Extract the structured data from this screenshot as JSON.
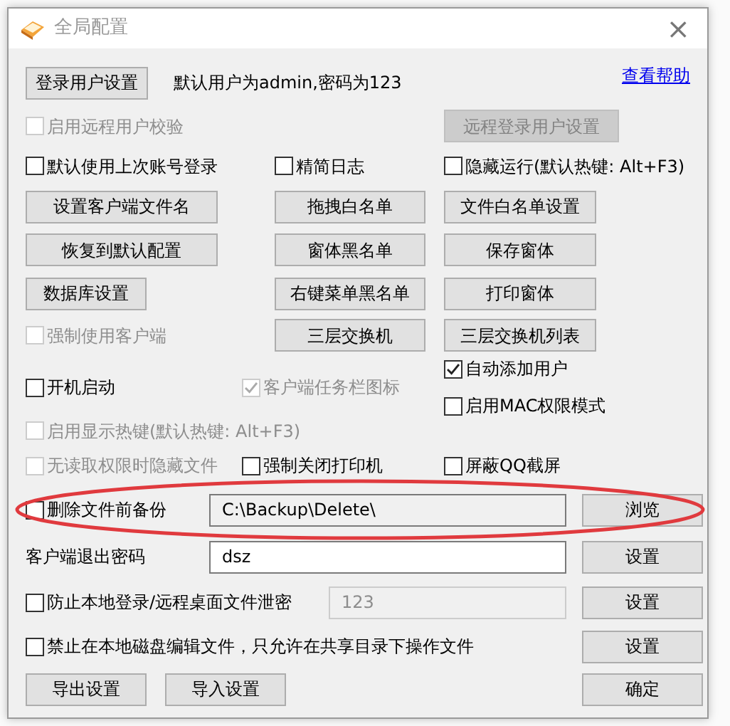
{
  "window": {
    "title": "全局配置",
    "close": "×"
  },
  "rows": [
    {
      "items": [
        {
          "kind": "button",
          "label": "登录用户设置",
          "disabled": false
        },
        {
          "kind": "text",
          "text": "默认用户为admin,密码为123"
        },
        {
          "kind": "link",
          "text": "查看帮助"
        }
      ]
    },
    {
      "items": [
        {
          "kind": "checkbox",
          "label": "启用远程用户校验",
          "checked": false,
          "disabled": true
        },
        {
          "kind": "button",
          "label": "远程登录用户设置",
          "disabled": true
        }
      ]
    },
    {
      "items": [
        {
          "kind": "checkbox",
          "label": "默认使用上次账号登录",
          "checked": false,
          "disabled": false
        },
        {
          "kind": "checkbox",
          "label": "精简日志",
          "checked": false,
          "disabled": false
        },
        {
          "kind": "checkbox",
          "label": "隐藏运行(默认热键: Alt+F3)",
          "checked": false,
          "disabled": false
        }
      ]
    },
    {
      "items": [
        {
          "kind": "button",
          "label": "设置客户端文件名",
          "disabled": false
        },
        {
          "kind": "button",
          "label": "拖拽白名单",
          "disabled": false
        },
        {
          "kind": "button",
          "label": "文件白名单设置",
          "disabled": false
        }
      ]
    },
    {
      "items": [
        {
          "kind": "button",
          "label": "恢复到默认配置",
          "disabled": false
        },
        {
          "kind": "button",
          "label": "窗体黑名单",
          "disabled": false
        },
        {
          "kind": "button",
          "label": "保存窗体",
          "disabled": false
        }
      ]
    },
    {
      "items": [
        {
          "kind": "button",
          "label": "数据库设置",
          "disabled": false
        },
        {
          "kind": "button",
          "label": "右键菜单黑名单",
          "disabled": false
        },
        {
          "kind": "button",
          "label": "打印窗体",
          "disabled": false
        }
      ]
    },
    {
      "items": [
        {
          "kind": "checkbox",
          "label": "强制使用客户端",
          "checked": false,
          "disabled": true
        },
        {
          "kind": "button",
          "label": "三层交换机",
          "disabled": false
        },
        {
          "kind": "button",
          "label": "三层交换机列表",
          "disabled": false
        }
      ]
    },
    {
      "items": [
        {
          "kind": "checkbox",
          "label": "开机启动",
          "checked": false,
          "disabled": false
        },
        {
          "kind": "checkbox",
          "label": "客户端任务栏图标",
          "checked": true,
          "disabled": true
        },
        {
          "kind": "checkbox",
          "label": "自动添加用户",
          "checked": true,
          "disabled": false
        },
        {
          "kind": "checkbox",
          "label": "启用MAC权限模式",
          "checked": false,
          "disabled": false
        }
      ]
    },
    {
      "items": [
        {
          "kind": "checkbox",
          "label": "启用显示热键(默认热键: Alt+F3)",
          "checked": false,
          "disabled": true
        }
      ]
    },
    {
      "items": [
        {
          "kind": "checkbox",
          "label": "无读取权限时隐藏文件",
          "checked": false,
          "disabled": true
        },
        {
          "kind": "checkbox",
          "label": "强制关闭打印机",
          "checked": false,
          "disabled": false
        },
        {
          "kind": "checkbox",
          "label": "屏蔽QQ截屏",
          "checked": false,
          "disabled": false
        }
      ]
    },
    {
      "highlighted": true,
      "items": [
        {
          "kind": "checkbox",
          "label": "删除文件前备份",
          "checked": false,
          "disabled": false
        },
        {
          "kind": "field",
          "value": "C:\\Backup\\Delete\\",
          "readonly": true,
          "disabled": false
        },
        {
          "kind": "button",
          "label": "浏览",
          "disabled": false
        }
      ]
    },
    {
      "items": [
        {
          "kind": "text",
          "text": "客户端退出密码"
        },
        {
          "kind": "field",
          "value": "dsz",
          "readonly": false,
          "disabled": false
        },
        {
          "kind": "button",
          "label": "设置",
          "disabled": false
        }
      ]
    },
    {
      "items": [
        {
          "kind": "checkbox",
          "label": "防止本地登录/远程桌面文件泄密",
          "checked": false,
          "disabled": false
        },
        {
          "kind": "field",
          "value": "123",
          "disabled": true
        },
        {
          "kind": "button",
          "label": "设置",
          "disabled": false
        }
      ]
    },
    {
      "items": [
        {
          "kind": "checkbox",
          "label": "禁止在本地磁盘编辑文件，只允许在共享目录下操作文件",
          "checked": false,
          "disabled": false
        },
        {
          "kind": "button",
          "label": "设置",
          "disabled": false
        }
      ]
    },
    {
      "items": [
        {
          "kind": "button",
          "label": "导出设置",
          "disabled": false
        },
        {
          "kind": "button",
          "label": "导入设置",
          "disabled": false
        },
        {
          "kind": "button",
          "label": "确定",
          "disabled": false
        }
      ]
    }
  ],
  "highlight": {
    "color": "#e03a3e"
  }
}
